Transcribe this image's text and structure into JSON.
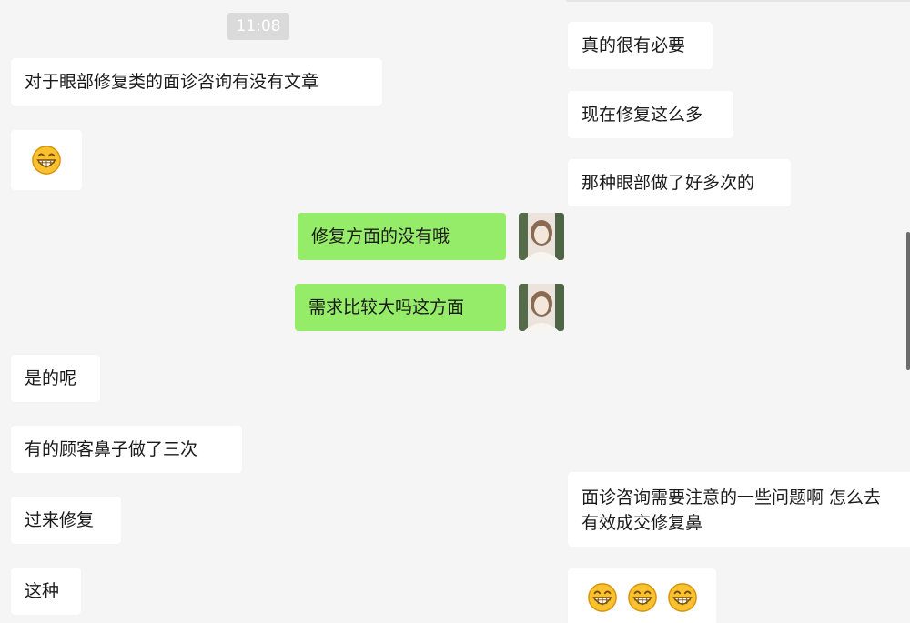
{
  "conversation": {
    "time": "11:08",
    "left_messages": {
      "m1": "对于眼部修复类的面诊咨询有没有文章",
      "m2_emoji": "grinning-face-emoji",
      "m3": "修复方面的没有哦",
      "m4": "需求比较大吗这方面",
      "m5": "是的呢",
      "m6": "有的顾客鼻子做了三次",
      "m7": "过来修复",
      "m8": "这种"
    },
    "right_messages": {
      "r1": "真的很有必要",
      "r2": "现在修复这么多",
      "r3": "那种眼部做了好多次的",
      "r4_line1": "面诊咨询需要注意的一些问题啊 怎么去",
      "r4_line2": "有效成交修复鼻",
      "r5_emoji": "grinning-face-emoji"
    }
  },
  "colors": {
    "background": "#f5f5f5",
    "incoming_bubble": "#ffffff",
    "outgoing_bubble": "#95ec69",
    "timestamp_bg": "#dadada"
  }
}
